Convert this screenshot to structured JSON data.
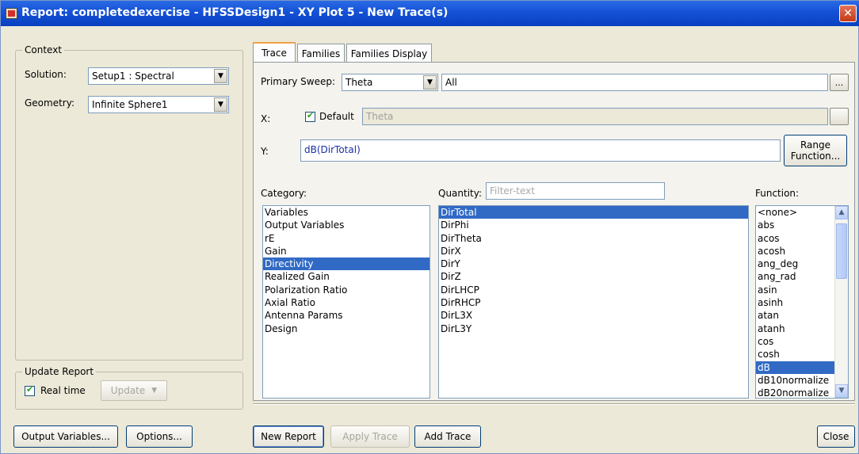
{
  "window": {
    "title": "Report: completedexercise - HFSSDesign1 - XY Plot 5 - New Trace(s)",
    "close_glyph": "✕"
  },
  "context": {
    "group_label": "Context",
    "solution_label": "Solution:",
    "solution_value": "Setup1 : Spectral",
    "geometry_label": "Geometry:",
    "geometry_value": "Infinite Sphere1"
  },
  "update_report": {
    "group_label": "Update Report",
    "realtime_label": "Real time",
    "realtime_checked": true,
    "update_button": "Update"
  },
  "tabs": [
    {
      "label": "Trace",
      "active": true
    },
    {
      "label": "Families",
      "active": false
    },
    {
      "label": "Families Display",
      "active": false
    }
  ],
  "trace": {
    "primary_sweep_label": "Primary Sweep:",
    "primary_sweep_value": "Theta",
    "primary_sweep_range": "All",
    "x_label": "X:",
    "default_label": "Default",
    "default_checked": true,
    "x_value": "Theta",
    "y_label": "Y:",
    "y_value": "dB(DirTotal)",
    "range_function_line1": "Range",
    "range_function_line2": "Function...",
    "ellipsis": "..."
  },
  "category": {
    "label": "Category:",
    "items": [
      "Variables",
      "Output Variables",
      "rE",
      "Gain",
      "Directivity",
      "Realized Gain",
      "Polarization Ratio",
      "Axial Ratio",
      "Antenna Params",
      "Design"
    ],
    "selected_index": 4
  },
  "quantity": {
    "label": "Quantity:",
    "filter_placeholder": "Filter-text",
    "items": [
      "DirTotal",
      "DirPhi",
      "DirTheta",
      "DirX",
      "DirY",
      "DirZ",
      "DirLHCP",
      "DirRHCP",
      "DirL3X",
      "DirL3Y"
    ],
    "selected_index": 0
  },
  "function": {
    "label": "Function:",
    "items": [
      "<none>",
      "abs",
      "acos",
      "acosh",
      "ang_deg",
      "ang_rad",
      "asin",
      "asinh",
      "atan",
      "atanh",
      "cos",
      "cosh",
      "dB",
      "dB10normalize",
      "dB20normalize"
    ],
    "selected_index": 12
  },
  "buttons": {
    "output_variables": "Output Variables...",
    "options": "Options...",
    "new_report": "New Report",
    "apply_trace": "Apply Trace",
    "add_trace": "Add Trace",
    "close": "Close"
  },
  "colors": {
    "titlebar": "#0a3fc0",
    "selection": "#316ac5",
    "dialog_bg": "#ece9d8"
  }
}
